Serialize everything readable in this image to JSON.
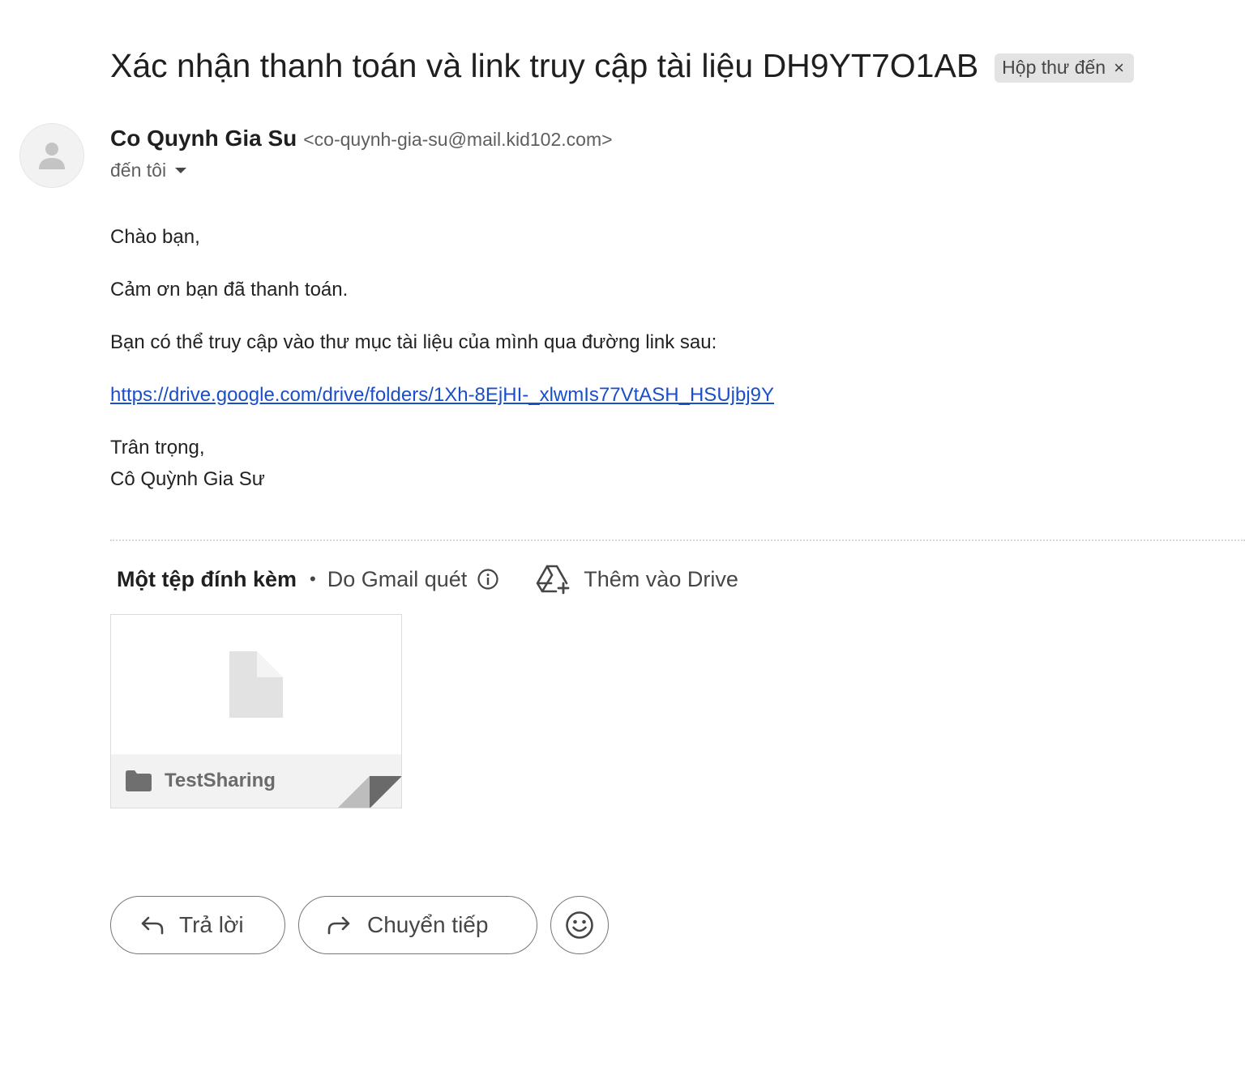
{
  "email": {
    "subject": "Xác nhận thanh toán và link truy cập tài liệu DH9YT7O1AB",
    "label": "Hộp thư đến",
    "label_close": "×",
    "sender_name": "Co Quynh Gia Su",
    "sender_email": "<co-quynh-gia-su@mail.kid102.com>",
    "recipient": "đến tôi"
  },
  "body": {
    "greeting": "Chào bạn,",
    "thanks": "Cảm ơn bạn đã thanh toán.",
    "instruction": "Bạn có thể truy cập vào thư mục tài liệu của mình qua đường link sau:",
    "link": "https://drive.google.com/drive/folders/1Xh-8EjHI-_xlwmIs77VtASH_HSUjbj9Y",
    "closing": "Trân trọng,",
    "signature": "Cô Quỳnh Gia Sư"
  },
  "attachments": {
    "count_label": "Một tệp đính kèm",
    "separator": "•",
    "scan_label": "Do Gmail quét",
    "drive_label": "Thêm vào Drive",
    "items": [
      {
        "name": "TestSharing",
        "icon": "folder-icon"
      }
    ]
  },
  "actions": {
    "reply": "Trả lời",
    "forward": "Chuyển tiếp",
    "emoji_icon": "emoji-icon"
  },
  "colors": {
    "link": "#1a4fc9",
    "chip_bg": "#e3e3e3",
    "button_border": "#747775"
  }
}
